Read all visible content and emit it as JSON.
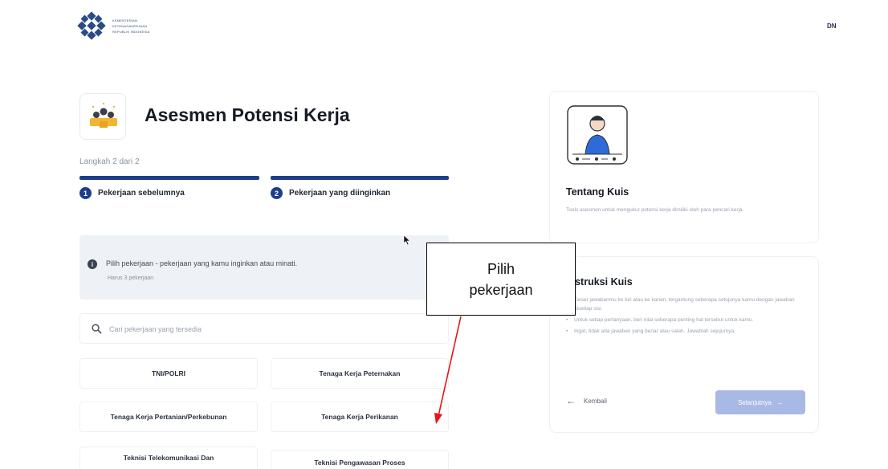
{
  "header": {
    "logo_lines": [
      "KEMENTERIAN",
      "KETENAGAKERJAAN",
      "REPUBLIK INDONESIA"
    ],
    "user_initials": "DN"
  },
  "main": {
    "title": "Asesmen Potensi Kerja",
    "step_counter": "Langkah 2 dari 2",
    "steps": [
      {
        "number": "1",
        "label": "Pekerjaan sebelumnya"
      },
      {
        "number": "2",
        "label": "Pekerjaan yang diinginkan"
      }
    ],
    "info": {
      "text": "Pilih pekerjaan - pekerjaan yang kamu inginkan atau minati.",
      "sub": "Harus 3 pekerjaan"
    },
    "search": {
      "placeholder": "Cari pekerjaan yang tersedia"
    },
    "jobs": [
      "TNI/POLRI",
      "Tenaga Kerja Peternakan",
      "Tenaga Kerja Pertanian/Perkebunan",
      "Tenaga Kerja Perikanan",
      "Teknisi Telekomunikasi Dan",
      "Teknisi Pengawasan Proses"
    ]
  },
  "side": {
    "about_title": "Tentang Kuis",
    "about_desc": "Tools asesmen untuk mengukur potensi kerja dimiliki oleh para pencari kerja.",
    "instr_title": "Instruksi Kuis",
    "instr_items": [
      "Geser jawabanmu ke kiri atau ke kanan, tergantung seberapa setujunya kamu dengan jawaban disetiap sisi.",
      "Untuk setiap pertanyaan, beri nilai seberapa penting hal tersebut untuk kamu.",
      "Ingat, tidak ada jawaban yang benar atau salah. Jawablah sejujurnya."
    ],
    "back_label": "Kembali",
    "next_label": "Selanjutnya"
  },
  "callout": {
    "lines": [
      "Pilih",
      "pekerjaan"
    ]
  },
  "colors": {
    "primary": "#1d3e8a",
    "next_button": "#a9b9e6",
    "info_bg": "#eef1f5",
    "arrow": "#e8141b"
  }
}
